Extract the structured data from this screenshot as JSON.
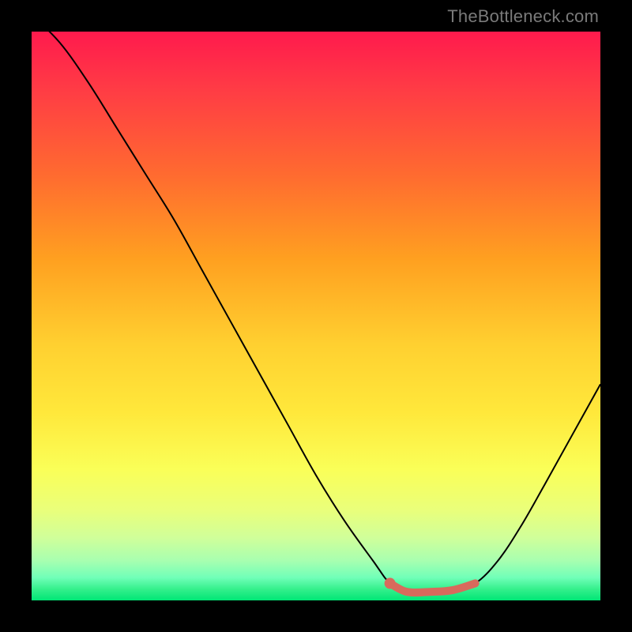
{
  "watermark": "TheBottleneck.com",
  "chart_data": {
    "type": "line",
    "title": "",
    "xlabel": "",
    "ylabel": "",
    "xlim": [
      0,
      100
    ],
    "ylim": [
      0,
      100
    ],
    "grid": false,
    "legend": false,
    "series": [
      {
        "name": "bottleneck-curve",
        "x": [
          0,
          5,
          10,
          15,
          20,
          25,
          30,
          35,
          40,
          45,
          50,
          55,
          60,
          63,
          66,
          70,
          74,
          78,
          82,
          86,
          90,
          95,
          100
        ],
        "values": [
          103,
          98,
          91,
          83,
          75,
          67,
          58,
          49,
          40,
          31,
          22,
          14,
          7,
          3,
          1.5,
          1.5,
          1.8,
          3,
          7,
          13,
          20,
          29,
          38
        ]
      }
    ],
    "highlight": {
      "name": "optimal-range",
      "x": [
        63,
        66,
        70,
        74,
        78
      ],
      "values": [
        3,
        1.5,
        1.5,
        1.8,
        3
      ]
    }
  }
}
